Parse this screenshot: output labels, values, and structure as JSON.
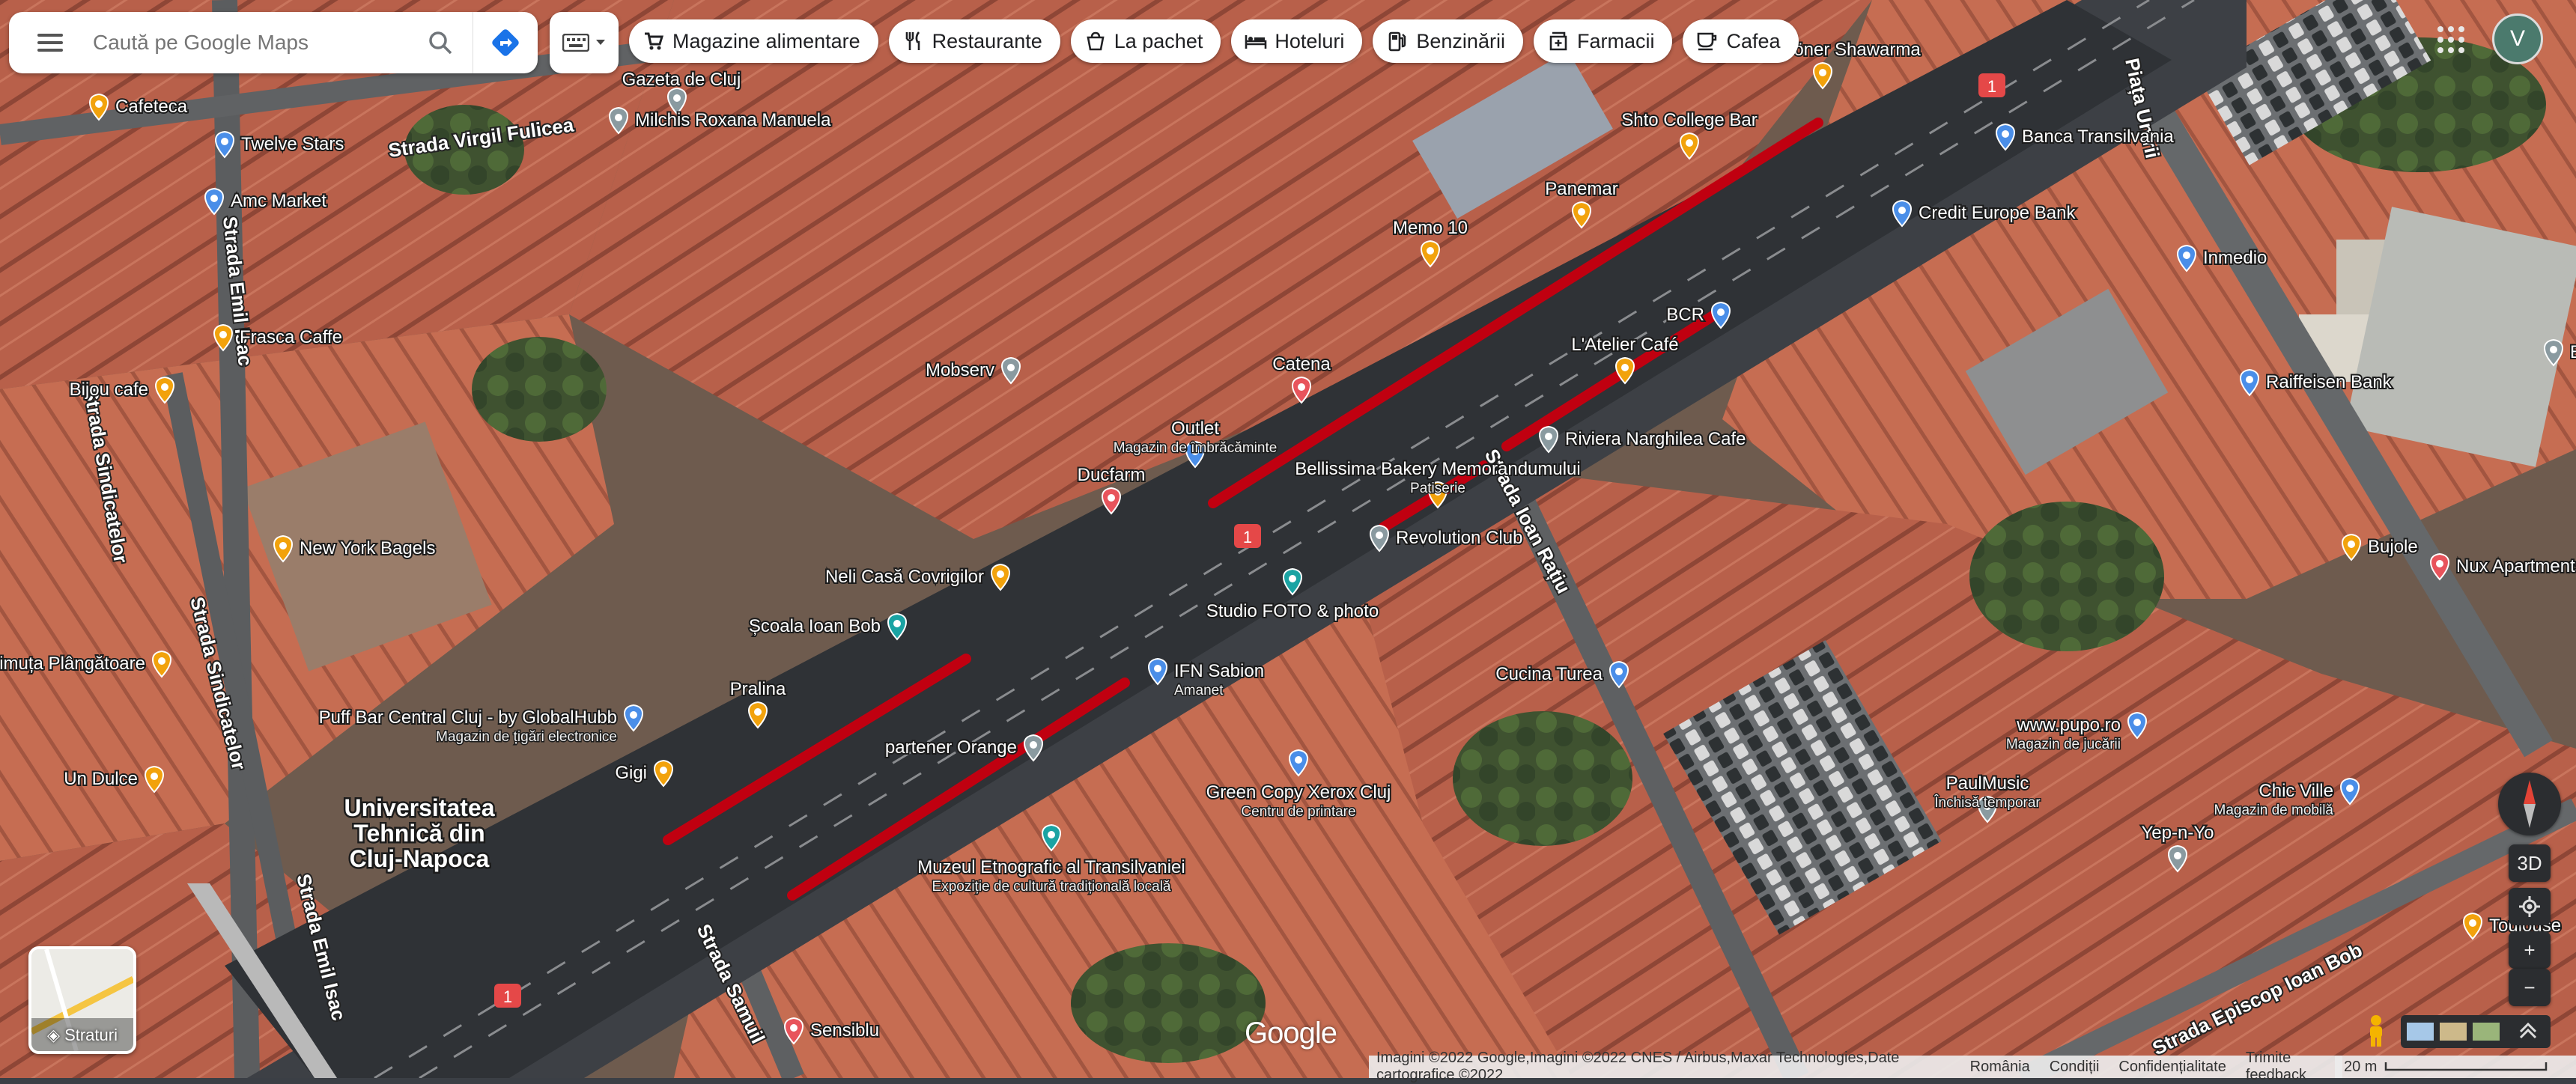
{
  "search": {
    "placeholder": "Caută pe Google Maps"
  },
  "chips": [
    {
      "label": "Magazine alimentare",
      "icon": "cart-icon"
    },
    {
      "label": "Restaurante",
      "icon": "fork-knife-icon"
    },
    {
      "label": "La pachet",
      "icon": "takeout-icon"
    },
    {
      "label": "Hoteluri",
      "icon": "bed-icon"
    },
    {
      "label": "Benzinării",
      "icon": "gas-pump-icon"
    },
    {
      "label": "Farmacii",
      "icon": "pharmacy-icon"
    },
    {
      "label": "Cafea",
      "icon": "coffee-cup-icon"
    }
  ],
  "account": {
    "initial": "V"
  },
  "layers": {
    "label": "Straturi"
  },
  "controls": {
    "tilt": "3D",
    "zoom_in": "+",
    "zoom_out": "−"
  },
  "footer": {
    "attribution": "Imagini ©2022 Google,Imagini ©2022 CNES / Airbus,Maxar Technologies,Date cartografice ©2022",
    "country": "România",
    "terms": "Condiții",
    "privacy": "Confidențialitate",
    "feedback": "Trimite feedback",
    "scale": "20 m"
  },
  "logo": "Google",
  "colors": {
    "route_highlight": "#c00010",
    "food_pin": "#f2a20c",
    "shop_pin": "#4a8ee8",
    "restaurant_pin": "#e8545c",
    "attraction_pin": "#1aa3a3",
    "gray_pin": "#8a9aa0",
    "road_shield": "#e54848"
  },
  "streets": [
    {
      "name": "Strada Virgil Fulicea"
    },
    {
      "name": "Strada Emil Isac"
    },
    {
      "name": "Strada Sindicatelor"
    },
    {
      "name": "Strada Sindicatelor"
    },
    {
      "name": "Strada Ioan Rațiu"
    },
    {
      "name": "Strada Samuil"
    },
    {
      "name": "Piața Unirii"
    },
    {
      "name": "Strada Episcop Ioan Bob"
    },
    {
      "name": "Strada Emil Isac"
    }
  ],
  "route_shield": "1",
  "places": [
    {
      "name": "Cafeteca",
      "type": "food"
    },
    {
      "name": "Twelve Stars",
      "type": "shop"
    },
    {
      "name": "Gazeta de Cluj",
      "type": "gray"
    },
    {
      "name": "Milchis Roxana Manuela",
      "type": "gray"
    },
    {
      "name": "Amc Market",
      "type": "shop"
    },
    {
      "name": "Frasca Caffe",
      "type": "food"
    },
    {
      "name": "Bijou cafe",
      "type": "food"
    },
    {
      "name": "New York Bagels",
      "type": "food"
    },
    {
      "name": "Maimuța Plângătoare",
      "type": "food"
    },
    {
      "name": "Un Dulce",
      "type": "food"
    },
    {
      "name": "Puff Bar Central Cluj - by GlobalHubb",
      "sub": "Magazin de țigări electronice",
      "type": "shop"
    },
    {
      "name": "Gigi",
      "type": "food"
    },
    {
      "name": "Pralina",
      "type": "food"
    },
    {
      "name": "Școala Ioan Bob",
      "type": "attraction"
    },
    {
      "name": "Neli Casă Covrigilor",
      "type": "food"
    },
    {
      "name": "Ducfarm",
      "type": "restaurant"
    },
    {
      "name": "Mobserv",
      "type": "gray"
    },
    {
      "name": "Outlet",
      "sub": "Magazin de îmbrăcăminte",
      "type": "shop"
    },
    {
      "name": "Catena",
      "type": "restaurant"
    },
    {
      "name": "Memo 10",
      "type": "food"
    },
    {
      "name": "Panemar",
      "type": "food"
    },
    {
      "name": "Shto College Bar",
      "type": "food"
    },
    {
      "name": "Sultan Döner Shawarma",
      "type": "food"
    },
    {
      "name": "Banca Transilvania",
      "type": "shop"
    },
    {
      "name": "Credit Europe Bank",
      "type": "shop"
    },
    {
      "name": "Inmedio",
      "type": "shop"
    },
    {
      "name": "BCR",
      "type": "shop"
    },
    {
      "name": "L'Atelier Café",
      "type": "food"
    },
    {
      "name": "Riviera Narghilea Cafe",
      "type": "gray"
    },
    {
      "name": "Bellissima Bakery Memorandumului",
      "sub": "Patiserie",
      "type": "food"
    },
    {
      "name": "Revolution Club",
      "type": "gray"
    },
    {
      "name": "Studio FOTO & photo",
      "type": "attraction"
    },
    {
      "name": "IFN Sabion",
      "sub": "Amanet",
      "type": "shop"
    },
    {
      "name": "partener Orange",
      "type": "gray"
    },
    {
      "name": "Muzeul Etnografic al Transilvaniei",
      "sub": "Expoziție de cultură tradițională locală",
      "type": "attraction"
    },
    {
      "name": "Green Copy Xerox Cluj",
      "sub": "Centru de printare",
      "type": "shop"
    },
    {
      "name": "Cucina Turea",
      "type": "shop"
    },
    {
      "name": "PaulMusic",
      "sub": "Închisă temporar",
      "type": "gray"
    },
    {
      "name": "Raiffeisen Bank",
      "type": "shop"
    },
    {
      "name": "Bujole",
      "type": "food"
    },
    {
      "name": "Nux Apartments Cluj-Napoca",
      "type": "restaurant"
    },
    {
      "name": "www.pupo.ro",
      "sub": "Magazin de jucării",
      "type": "shop"
    },
    {
      "name": "Chic Ville",
      "sub": "Magazin de mobilă",
      "type": "shop"
    },
    {
      "name": "Yep-n-Yo",
      "type": "gray"
    },
    {
      "name": "Toulouse",
      "type": "food"
    },
    {
      "name": "Sensiblu",
      "type": "restaurant"
    },
    {
      "name": "Biserica c",
      "type": "gray"
    },
    {
      "name": "Universitatea Tehnică din Cluj-Napoca",
      "type": "label"
    }
  ]
}
